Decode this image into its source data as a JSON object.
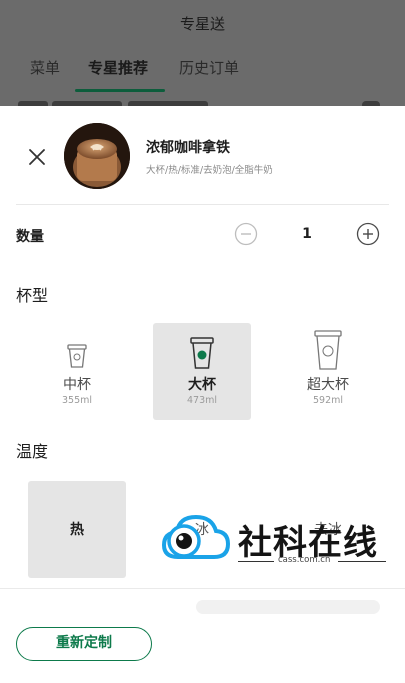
{
  "header": {
    "title": "专星送",
    "tabs": [
      {
        "label": "菜单",
        "active": false
      },
      {
        "label": "专星推荐",
        "active": true
      },
      {
        "label": "历史订单",
        "active": false
      }
    ]
  },
  "product": {
    "name": "浓郁咖啡拿铁",
    "description": "大杯/热/标准/去奶泡/全脂牛奶"
  },
  "quantity": {
    "label": "数量",
    "value": "1"
  },
  "cup_size": {
    "label": "杯型",
    "options": [
      {
        "name": "中杯",
        "volume": "355ml",
        "selected": false
      },
      {
        "name": "大杯",
        "volume": "473ml",
        "selected": true
      },
      {
        "name": "超大杯",
        "volume": "592ml",
        "selected": false
      }
    ]
  },
  "temperature": {
    "label": "温度",
    "options": [
      {
        "name": "热",
        "selected": true
      },
      {
        "name": "冰",
        "selected": false
      },
      {
        "name": "去冰",
        "selected": false
      }
    ]
  },
  "footer": {
    "reset_label": "重新定制"
  },
  "watermark": {
    "title": "社科在线",
    "url": "cass.com.cn"
  },
  "colors": {
    "accent": "#0d7a4b",
    "selected_bg": "#e5e5e5",
    "overlay": "#6b6b6b"
  }
}
